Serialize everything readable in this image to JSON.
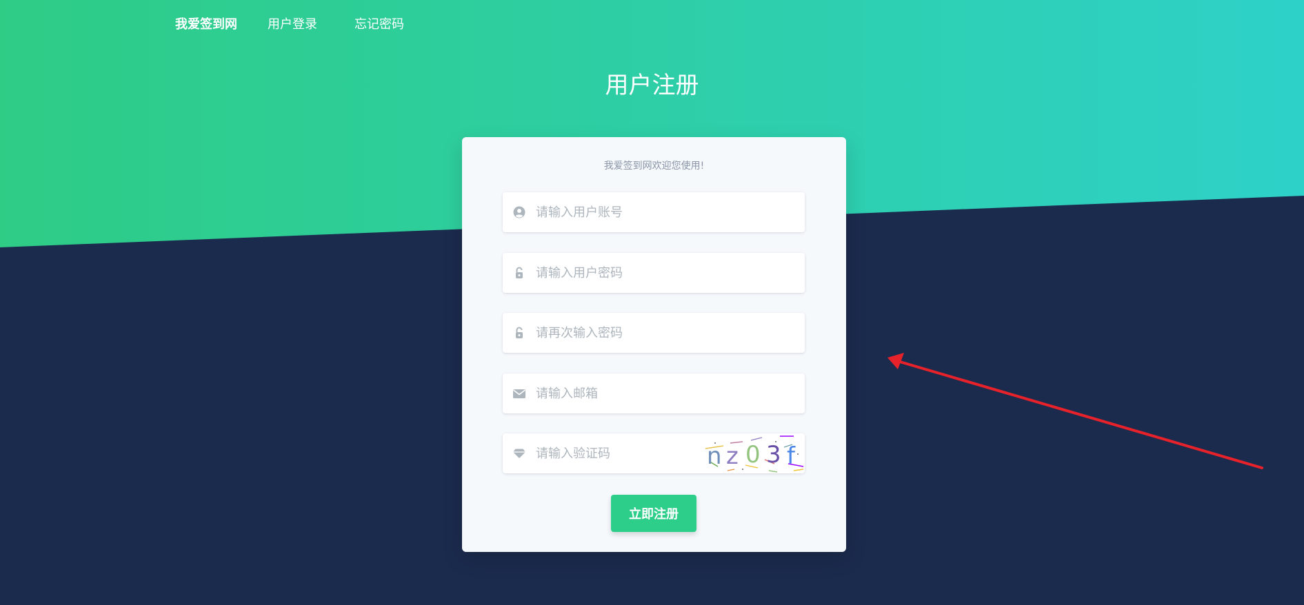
{
  "nav": {
    "brand": "我爱签到网",
    "links": [
      "用户登录",
      "忘记密码"
    ]
  },
  "page": {
    "title": "用户注册"
  },
  "form": {
    "welcome": "我爱签到网欢迎您使用!",
    "fields": [
      {
        "placeholder": "请输入用户账号",
        "icon": "user-circle-icon"
      },
      {
        "placeholder": "请输入用户密码",
        "icon": "unlock-icon"
      },
      {
        "placeholder": "请再次输入密码",
        "icon": "unlock-icon"
      },
      {
        "placeholder": "请输入邮箱",
        "icon": "envelope-icon"
      },
      {
        "placeholder": "请输入验证码",
        "icon": "diamond-icon"
      }
    ],
    "captcha_text": "nz03f",
    "submit_label": "立即注册"
  },
  "colors": {
    "green": "#2dce89",
    "teal": "#2ed1c8",
    "navy": "#1b2b4d",
    "card": "#f6f9fc",
    "annotation_arrow": "#e8222a"
  }
}
